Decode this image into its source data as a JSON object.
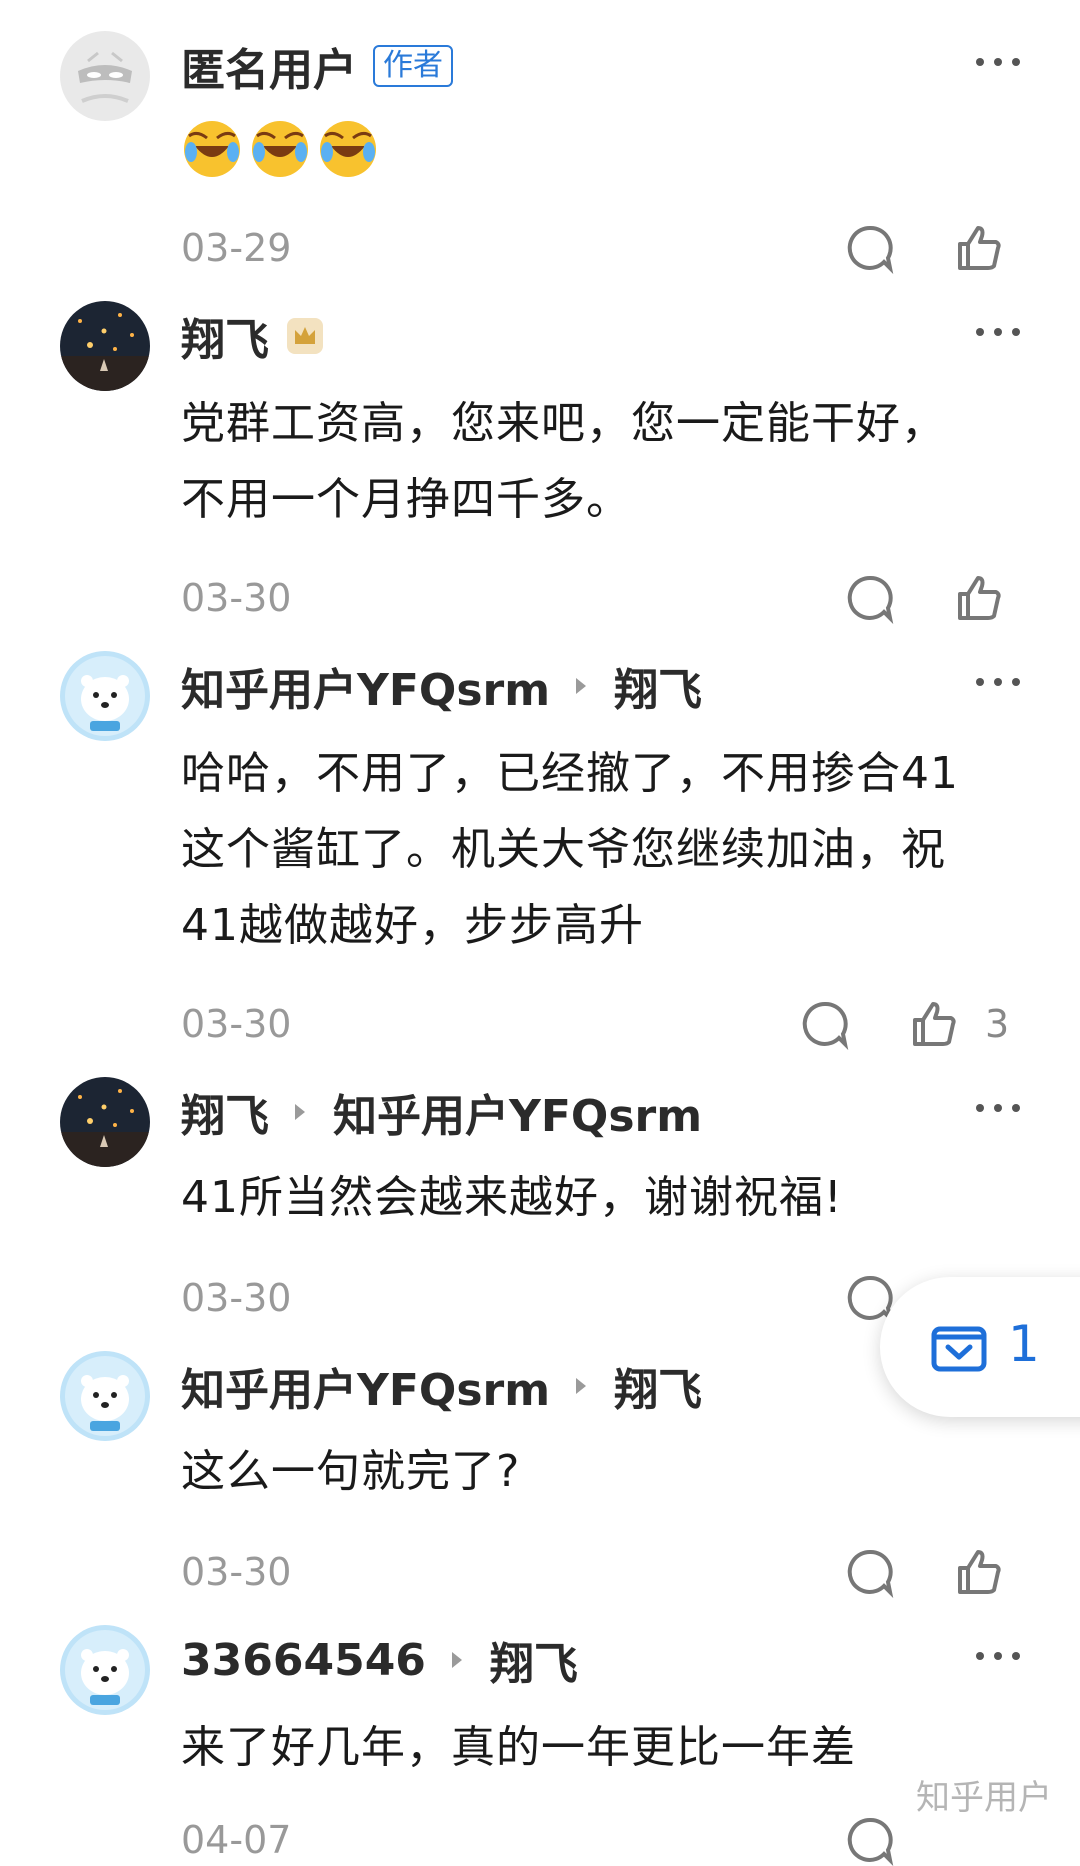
{
  "comments": [
    {
      "user": "匿名用户",
      "author_badge": "作者",
      "avatar": "anonymous-mask-avatar",
      "emojis": [
        "laugh-cry-emoji",
        "laugh-cry-emoji",
        "laugh-cry-emoji"
      ],
      "date": "03-29"
    },
    {
      "user": "翔飞",
      "avatar": "lanterns-night-photo",
      "badge_icon": "crown-badge-icon",
      "text": "党群工资高，您来吧，您一定能干好，不用一个月挣四千多。",
      "date": "03-30"
    },
    {
      "user": "知乎用户YFQsrm",
      "reply_to": "翔飞",
      "avatar": "polar-bear-avatar",
      "text": "哈哈，不用了，已经撤了，不用掺合41这个酱缸了。机关大爷您继续加油，祝41越做越好，步步高升",
      "date": "03-30",
      "likes": "3"
    },
    {
      "user": "翔飞",
      "reply_to": "知乎用户YFQsrm",
      "avatar": "lanterns-night-photo",
      "text": "41所当然会越来越好，谢谢祝福!",
      "date": "03-30"
    },
    {
      "user": "知乎用户YFQsrm",
      "reply_to": "翔飞",
      "avatar": "polar-bear-avatar",
      "text": "这么一句就完了?",
      "date": "03-30"
    },
    {
      "user": "33664546",
      "reply_to": "翔飞",
      "avatar": "polar-bear-avatar",
      "text": "来了好几年，真的一年更比一年差",
      "date": "04-07"
    }
  ],
  "floating_button": {
    "icon": "collapse-reply-icon",
    "count": "1"
  },
  "watermark": "知乎用户",
  "colors": {
    "link_blue": "#2a7ad9",
    "meta_gray": "#999999",
    "text": "#1a1a1a"
  }
}
